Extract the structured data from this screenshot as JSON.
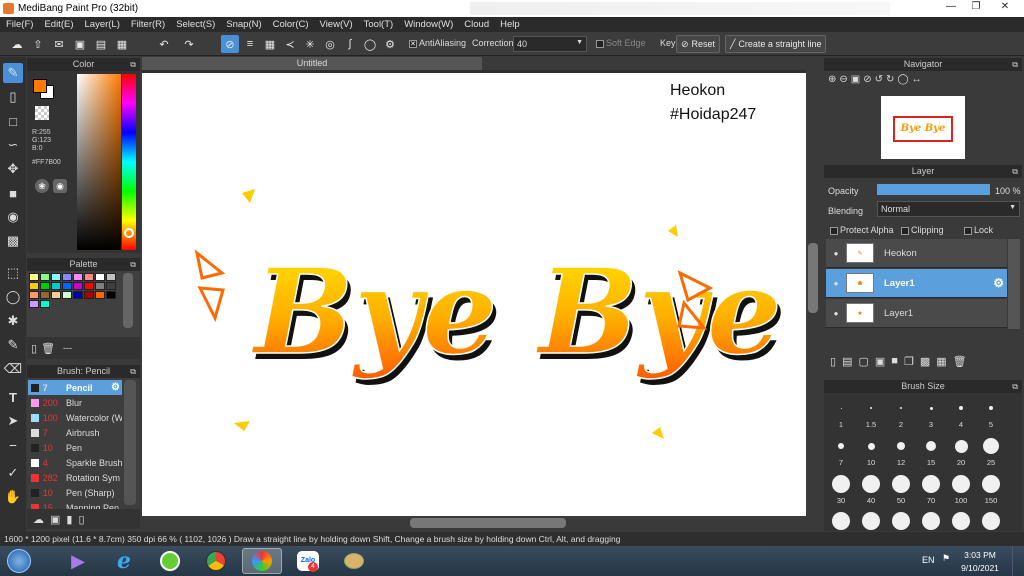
{
  "window": {
    "title": "MediBang Paint Pro (32bit)"
  },
  "menu": [
    "File(F)",
    "Edit(E)",
    "Layer(L)",
    "Filter(R)",
    "Select(S)",
    "Snap(N)",
    "Color(C)",
    "View(V)",
    "Tool(T)",
    "Window(W)",
    "Cloud",
    "Help"
  ],
  "toolbar": {
    "antialiasing_label": "AntiAliasing",
    "correction_label": "Correction",
    "correction_value": "40",
    "soft_edge_label": "Soft Edge",
    "key_label": "Key",
    "reset_label": "Reset",
    "straight_line_label": "Create a straight line"
  },
  "color_panel": {
    "title": "Color",
    "r": "R:255",
    "g": "G:123",
    "b": "B:0",
    "hex": "#FF7B00",
    "foreground": "#ff7b00",
    "background": "#ffffff"
  },
  "palette_panel": {
    "title": "Palette",
    "footer": "---",
    "swatches": [
      "#ffff88",
      "#88ff88",
      "#88ffff",
      "#8888ff",
      "#ff88ff",
      "#ff8888",
      "#ffffff",
      "#c0c0c0",
      "#ffcc00",
      "#00cc00",
      "#00cccc",
      "#0066ff",
      "#cc00cc",
      "#ff0000",
      "#808080",
      "#404040",
      "#ff9966",
      "#996633",
      "#ffcc99",
      "#ccffcc",
      "#0000aa",
      "#aa0000",
      "#ff6600",
      "#000000",
      "#cc99ff",
      "#00ffcc"
    ]
  },
  "brush_panel": {
    "title": "Brush: Pencil",
    "items": [
      {
        "size": "7",
        "name": "Pencil",
        "color": "#222222",
        "selected": true
      },
      {
        "size": "200",
        "name": "Blur",
        "color": "#ff99ee",
        "selected": false
      },
      {
        "size": "100",
        "name": "Watercolor (W",
        "color": "#99ddff",
        "selected": false
      },
      {
        "size": "7",
        "name": "Airbrush",
        "color": "#dddddd",
        "selected": false
      },
      {
        "size": "10",
        "name": "Pen",
        "color": "#222222",
        "selected": false
      },
      {
        "size": "4",
        "name": "Sparkle Brush",
        "color": "#ffffff",
        "selected": false
      },
      {
        "size": "282",
        "name": "Rotation Sym",
        "color": "#ee3333",
        "selected": false
      },
      {
        "size": "10",
        "name": "Pen (Sharp)",
        "color": "#222222",
        "selected": false
      },
      {
        "size": "15",
        "name": "Mapping Pen",
        "color": "#ee3333",
        "selected": false
      }
    ]
  },
  "document": {
    "tab_title": "Untitled",
    "watermark_line1": "Heokon",
    "watermark_line2": "#Hoidap247",
    "artwork_text": "Bye Bye"
  },
  "navigator": {
    "title": "Navigator"
  },
  "layer_panel": {
    "title": "Layer",
    "opacity_label": "Opacity",
    "opacity_value": "100 %",
    "opacity_fraction": 1.0,
    "blending_label": "Blending",
    "blending_value": "Normal",
    "protect_alpha": "Protect Alpha",
    "clipping": "Clipping",
    "lock": "Lock",
    "layers": [
      {
        "name": "Heokon",
        "selected": false
      },
      {
        "name": "Layer1",
        "selected": true
      },
      {
        "name": "Layer1",
        "selected": false
      }
    ]
  },
  "brush_size_panel": {
    "title": "Brush Size",
    "sizes": [
      "1",
      "1.5",
      "2",
      "3",
      "4",
      "5",
      "7",
      "10",
      "12",
      "15",
      "20",
      "25",
      "30",
      "40",
      "50",
      "70",
      "100",
      "150"
    ]
  },
  "status": {
    "pixel": "1600 * 1200 pixel",
    "cm": "(11.6 * 8.7cm)",
    "dpi": "350 dpi",
    "zoom": "66 %",
    "coords": "( 1102, 1026 )",
    "hint": "Draw a straight line by holding down Shift, Change a brush size by holding down Ctrl, Alt, and dragging"
  },
  "taskbar": {
    "lang": "EN",
    "time": "3:03 PM",
    "date": "9/10/2021",
    "zalo_label": "Zalo",
    "zalo_badge": "4"
  }
}
